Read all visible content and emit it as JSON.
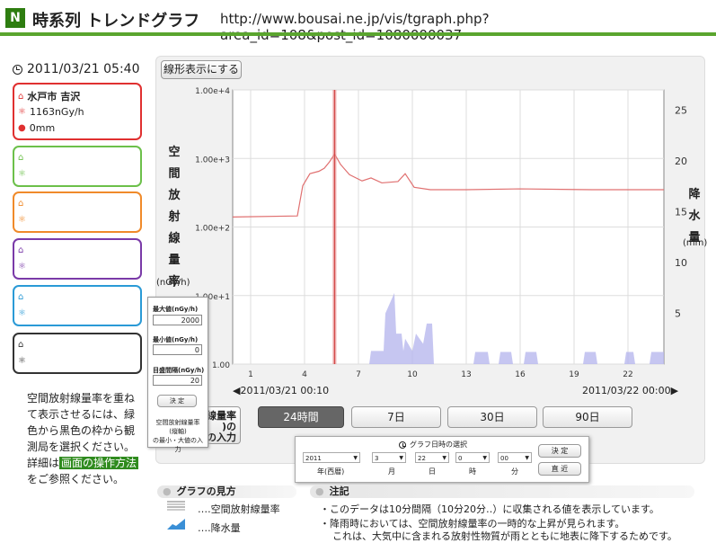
{
  "header": {
    "logo": "N",
    "title": "時系列 トレンドグラフ",
    "url": "http://www.bousai.ne.jp/vis/tgraph.php?area_id=108&post_id=1080000037"
  },
  "timestamp": "2011/03/21 05:40",
  "stations": [
    {
      "name": "水戸市 吉沢",
      "dose": "1163nGy/h",
      "rain": "0mm",
      "color": "#e03030"
    },
    {
      "name": "",
      "dose": "",
      "rain": "",
      "color": "#6cc04a"
    },
    {
      "name": "",
      "dose": "",
      "rain": "",
      "color": "#f08a2a"
    },
    {
      "name": "",
      "dose": "",
      "rain": "",
      "color": "#7a3aa8"
    },
    {
      "name": "",
      "dose": "",
      "rain": "",
      "color": "#2a9ad6"
    },
    {
      "name": "",
      "dose": "",
      "rain": "",
      "color": "#333333"
    }
  ],
  "help_text": {
    "line1": "空間放射線量率を重ね",
    "line2": "て表示させるには、緑",
    "line3": "色から黒色の枠から観",
    "line4": "測局を選択ください。",
    "line5_pre": "詳細は",
    "link": "画面の操作方法",
    "line6": "をご参照ください。"
  },
  "toggle_button": "線形表示にする",
  "axis_left_label": "空間放射線量率",
  "axis_left_unit": "(nGy/h)",
  "axis_right_label": "降水量",
  "axis_right_unit": "(mm)",
  "range_start": "2011/03/21 00:10",
  "range_end": "2011/03/22 00:00",
  "period_tabs": [
    "24時間",
    "7日",
    "30日",
    "90日"
  ],
  "hidden_tab_text": {
    "line1": "線量率",
    "line2": ")の",
    "line3": "の入力"
  },
  "popup": {
    "max_label": "最大値(nGy/h)",
    "max_value": "2000",
    "min_label": "最小値(nGy/h)",
    "min_value": "0",
    "interval_label": "目盛間隔(nGy/h)",
    "interval_value": "20",
    "confirm": "決 定",
    "desc1": "空間放射線量率",
    "desc2": "(縦軸)",
    "desc3": "の最小・大値の入力"
  },
  "date_selector": {
    "title": "グラフ日時の選択",
    "year": "2011",
    "month": "3",
    "day": "22",
    "hour": "0",
    "minute": "00",
    "year_label": "年(西暦)",
    "month_label": "月",
    "day_label": "日",
    "hour_label": "時",
    "minute_label": "分",
    "confirm": "決 定",
    "latest": "直 近"
  },
  "legend": {
    "title": "グラフの見方",
    "dose": "‥‥空間放射線量率",
    "rain": "‥‥降水量"
  },
  "notes": {
    "title": "注記",
    "line1": "・このデータは10分間隔（10分20分‥）に収集される値を表示しています。",
    "line2": "・降雨時においては、空間放射線量率の一時的な上昇が見られます。",
    "line3": "これは、大気中に含まれる放射性物質が雨とともに地表に降下するためです。"
  },
  "chart_data": {
    "type": "line",
    "ylim": [
      1,
      10000
    ],
    "y_scale": "log",
    "y_ticks": [
      "1.00e+4",
      "1.00e+3",
      "1.00e+2",
      "1.00e+1",
      "1.00"
    ],
    "y2lim": [
      0,
      27
    ],
    "y2_ticks": [
      "25",
      "20",
      "15",
      "10",
      "5"
    ],
    "x_ticks": [
      "1",
      "4",
      "7",
      "10",
      "13",
      "16",
      "19",
      "22"
    ],
    "xlim": [
      0,
      24
    ],
    "cursor_x": 5.67,
    "series": [
      {
        "kind": "line",
        "color": "#e07070",
        "points": [
          [
            0,
            140
          ],
          [
            3.6,
            145
          ],
          [
            3.9,
            400
          ],
          [
            4.3,
            600
          ],
          [
            4.8,
            650
          ],
          [
            5.1,
            720
          ],
          [
            5.4,
            900
          ],
          [
            5.67,
            1163
          ],
          [
            6,
            820
          ],
          [
            6.5,
            580
          ],
          [
            7.2,
            470
          ],
          [
            7.7,
            520
          ],
          [
            8.3,
            440
          ],
          [
            9.2,
            460
          ],
          [
            9.6,
            600
          ],
          [
            10.1,
            380
          ],
          [
            11,
            350
          ],
          [
            13,
            350
          ],
          [
            16,
            360
          ],
          [
            20,
            350
          ],
          [
            24,
            350
          ]
        ]
      },
      {
        "kind": "area",
        "color": "#b8b8ee",
        "points": [
          [
            7.6,
            0
          ],
          [
            7.7,
            1.3
          ],
          [
            8.4,
            1.3
          ],
          [
            8.5,
            5
          ],
          [
            9,
            7
          ],
          [
            9.1,
            3
          ],
          [
            9.4,
            3
          ],
          [
            9.5,
            1.3
          ],
          [
            9.6,
            2.5
          ],
          [
            10,
            1.3
          ],
          [
            10.2,
            3
          ],
          [
            10.6,
            2
          ],
          [
            10.8,
            4
          ],
          [
            11.1,
            4
          ],
          [
            11.2,
            0
          ],
          [
            13.4,
            0
          ],
          [
            13.5,
            1.2
          ],
          [
            14.2,
            1.2
          ],
          [
            14.3,
            0
          ],
          [
            14.8,
            0
          ],
          [
            14.9,
            1.2
          ],
          [
            15.5,
            1.2
          ],
          [
            15.6,
            0
          ],
          [
            16.2,
            0
          ],
          [
            16.3,
            1.2
          ],
          [
            16.9,
            1.2
          ],
          [
            17,
            0
          ],
          [
            19.5,
            0
          ],
          [
            19.6,
            1.2
          ],
          [
            20.2,
            1.2
          ],
          [
            20.3,
            0
          ],
          [
            21.8,
            0
          ],
          [
            21.9,
            1.2
          ],
          [
            22.3,
            1.2
          ],
          [
            22.4,
            0
          ],
          [
            23.2,
            0
          ],
          [
            23.3,
            1.2
          ],
          [
            24,
            1.2
          ]
        ]
      }
    ]
  }
}
